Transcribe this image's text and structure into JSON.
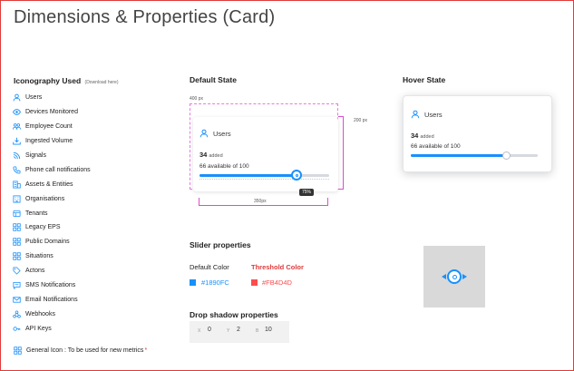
{
  "title": "Dimensions & Properties (Card)",
  "iconography": {
    "heading": "Iconography Used",
    "download": "(Download here)",
    "items": [
      {
        "label": "Users",
        "icon": "user-icon"
      },
      {
        "label": "Devices Monitored",
        "icon": "eye-icon"
      },
      {
        "label": "Employee Count",
        "icon": "employees-icon"
      },
      {
        "label": "Ingested Volume",
        "icon": "download-tray-icon"
      },
      {
        "label": "Signals",
        "icon": "signal-icon"
      },
      {
        "label": "Phone call notifications",
        "icon": "phone-icon"
      },
      {
        "label": "Assets & Entities",
        "icon": "assets-icon"
      },
      {
        "label": "Organisations",
        "icon": "building-icon"
      },
      {
        "label": "Tenants",
        "icon": "tenant-icon"
      },
      {
        "label": "Legacy EPS",
        "icon": "grid-icon"
      },
      {
        "label": "Public Domains",
        "icon": "grid-icon"
      },
      {
        "label": "Situations",
        "icon": "grid-icon"
      },
      {
        "label": "Actons",
        "icon": "tag-icon"
      },
      {
        "label": "SMS Notifications",
        "icon": "sms-icon"
      },
      {
        "label": "Email Notifications",
        "icon": "email-icon"
      },
      {
        "label": "Webhooks",
        "icon": "webhook-icon"
      },
      {
        "label": "API Keys",
        "icon": "key-icon"
      }
    ],
    "general": "General Icon : To be used for new metrics",
    "general_star": "*"
  },
  "default_state": {
    "heading": "Default State",
    "width_label": "400 px",
    "height_label": "200 px",
    "inner_width_label": "350px",
    "card": {
      "title": "Users",
      "count": "34",
      "count_suffix": "added",
      "available": "66 available of 100",
      "tooltip": "75%",
      "slider_fraction": 0.75
    }
  },
  "hover_state": {
    "heading": "Hover State",
    "card": {
      "title": "Users",
      "count": "34",
      "count_suffix": "added",
      "available": "66 available of 100",
      "slider_fraction": 0.75
    }
  },
  "slider_properties": {
    "heading": "Slider properties",
    "default_label": "Default Color",
    "threshold_label": "Threshold Color",
    "default_color": "#1890FC",
    "threshold_color": "#FB4D4D"
  },
  "drop_shadow": {
    "heading": "Drop shadow properties",
    "x_label": "X",
    "x_value": "0",
    "y_label": "Y",
    "y_value": "2",
    "b_label": "B",
    "b_value": "10"
  }
}
